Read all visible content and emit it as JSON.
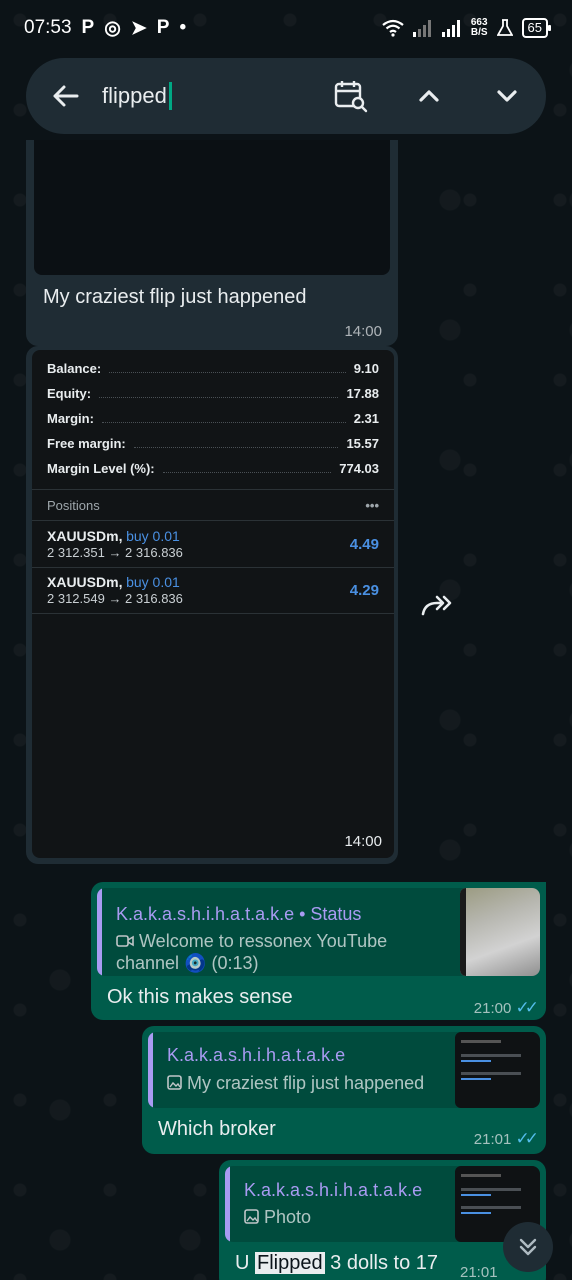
{
  "status_bar": {
    "time": "07:53",
    "app_icons": [
      "P",
      "◎",
      "➤",
      "P",
      "•"
    ],
    "net_speed_value": "663",
    "net_speed_unit": "B/S",
    "battery": "65"
  },
  "search": {
    "query": "flipped"
  },
  "messages": {
    "first": {
      "caption": "My craziest flip just happened",
      "time": "14:00"
    },
    "second": {
      "time": "14:00",
      "account": {
        "rows": [
          {
            "label": "Balance:",
            "value": "9.10"
          },
          {
            "label": "Equity:",
            "value": "17.88"
          },
          {
            "label": "Margin:",
            "value": "2.31"
          },
          {
            "label": "Free margin:",
            "value": "15.57"
          },
          {
            "label": "Margin Level (%):",
            "value": "774.03"
          }
        ],
        "positions_title": "Positions",
        "more": "•••",
        "positions": [
          {
            "symbol": "XAUUSDm,",
            "side": "buy 0.01",
            "prices": "2 312.351 → 2 316.836",
            "profit": "4.49"
          },
          {
            "symbol": "XAUUSDm,",
            "side": "buy 0.01",
            "prices": "2 312.549 → 2 316.836",
            "profit": "4.29"
          }
        ]
      }
    },
    "third": {
      "quote_author": "K.a.k.a.s.h.i.h.a.t.a.k.e • Status",
      "quote_text_line1": "Welcome to ressonex YouTube",
      "quote_text_line2": "channel 🧿 (0:13)",
      "text": "Ok this makes sense",
      "time": "21:00"
    },
    "fourth": {
      "quote_author": "K.a.k.a.s.h.i.h.a.t.a.k.e",
      "quote_text": "My craziest flip just happened",
      "text": "Which broker",
      "time": "21:01"
    },
    "fifth": {
      "quote_author": "K.a.k.a.s.h.i.h.a.t.a.k.e",
      "quote_text": "Photo",
      "text_before": "U ",
      "text_highlight": "Flipped",
      "text_after": " 3 dolls to 17",
      "time": "21:01"
    }
  },
  "colors": {
    "accent": "#00a884",
    "incoming": "#1f2c34",
    "outgoing": "#005c4b",
    "quote_author": "#a99bf2",
    "read_ticks": "#53bdeb"
  }
}
